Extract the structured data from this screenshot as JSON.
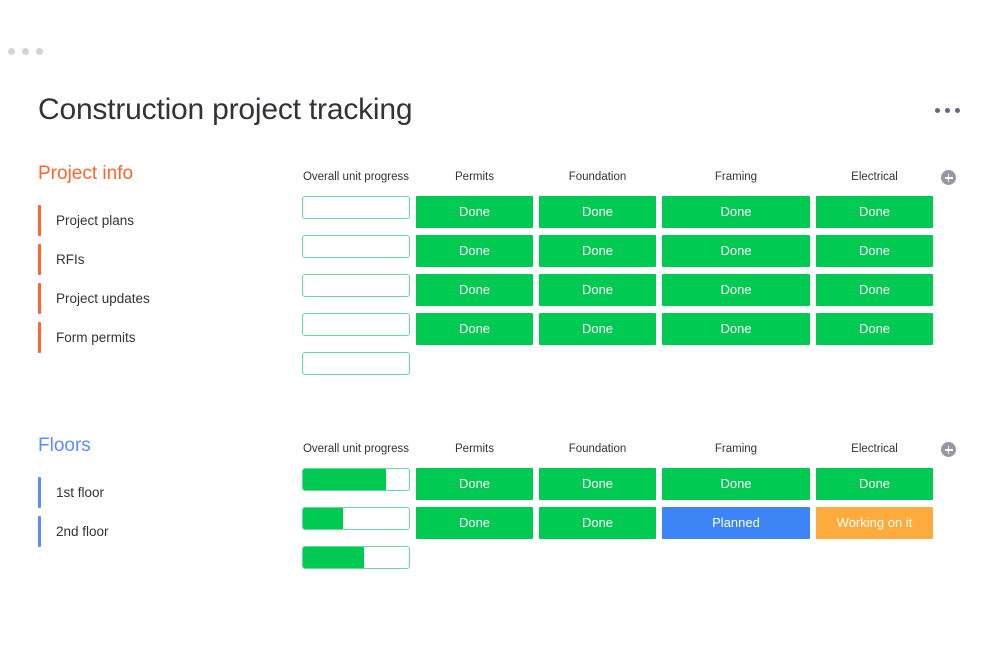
{
  "window": {
    "dots_count": 3,
    "dot_color": "#d5d3d9"
  },
  "header": {
    "title": "Construction project tracking",
    "menu_icon": "kebab-menu-icon"
  },
  "columns": {
    "progress_label": "Overall unit progress",
    "status_labels": [
      "Permits",
      "Foundation",
      "Framing",
      "Electrical"
    ],
    "add_column_icon": "plus-circle-icon"
  },
  "status_colors": {
    "done": "#00ca51",
    "planned": "#3d85f7",
    "working": "#fdab3d",
    "progress_fill": "#00ca51",
    "progress_border": "#66d9a0"
  },
  "groups": [
    {
      "name": "Project info",
      "color": "#ff642e",
      "items": [
        {
          "label": "Project plans",
          "progress": 0,
          "statuses": [
            "Done",
            "Done",
            "Done",
            "Done"
          ]
        },
        {
          "label": "RFIs",
          "progress": 0,
          "statuses": [
            "Done",
            "Done",
            "Done",
            "Done"
          ]
        },
        {
          "label": "Project updates",
          "progress": 0,
          "statuses": [
            "Done",
            "Done",
            "Done",
            "Done"
          ]
        },
        {
          "label": "Form permits",
          "progress": 0,
          "statuses": [
            "Done",
            "Done",
            "Done",
            "Done"
          ]
        }
      ],
      "summary": {
        "progress": 0
      }
    },
    {
      "name": "Floors",
      "color": "#5e8cf7",
      "items": [
        {
          "label": "1st floor",
          "progress": 78,
          "statuses": [
            "Done",
            "Done",
            "Done",
            "Done"
          ]
        },
        {
          "label": "2nd floor",
          "progress": 38,
          "statuses": [
            "Done",
            "Done",
            "Planned",
            "Working on it"
          ]
        }
      ],
      "summary": {
        "progress": 58
      }
    }
  ]
}
